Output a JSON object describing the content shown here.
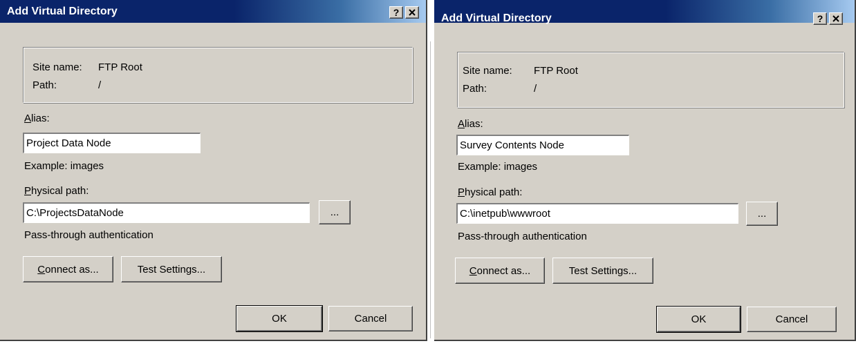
{
  "dialogs": [
    {
      "title": "Add Virtual Directory",
      "help_label": "?",
      "site_name_label": "Site name:",
      "site_name_value": "FTP Root",
      "path_label": "Path:",
      "path_value": "/",
      "alias_label": "Alias:",
      "alias_value": "Project Data Node",
      "example_text": "Example: images",
      "physical_path_label": "Physical path:",
      "physical_path_value": "C:\\ProjectsDataNode",
      "browse_label": "...",
      "auth_text": "Pass-through authentication",
      "connect_as_label": "Connect as...",
      "test_settings_label": "Test Settings...",
      "ok_label": "OK",
      "cancel_label": "Cancel"
    },
    {
      "title": "Add Virtual Directory",
      "help_label": "?",
      "site_name_label": "Site name:",
      "site_name_value": "FTP Root",
      "path_label": "Path:",
      "path_value": "/",
      "alias_label": "Alias:",
      "alias_value": "Survey Contents Node",
      "example_text": "Example: images",
      "physical_path_label": "Physical path:",
      "physical_path_value": "C:\\inetpub\\wwwroot",
      "browse_label": "...",
      "auth_text": "Pass-through authentication",
      "connect_as_label": "Connect as...",
      "test_settings_label": "Test Settings...",
      "ok_label": "OK",
      "cancel_label": "Cancel"
    }
  ]
}
